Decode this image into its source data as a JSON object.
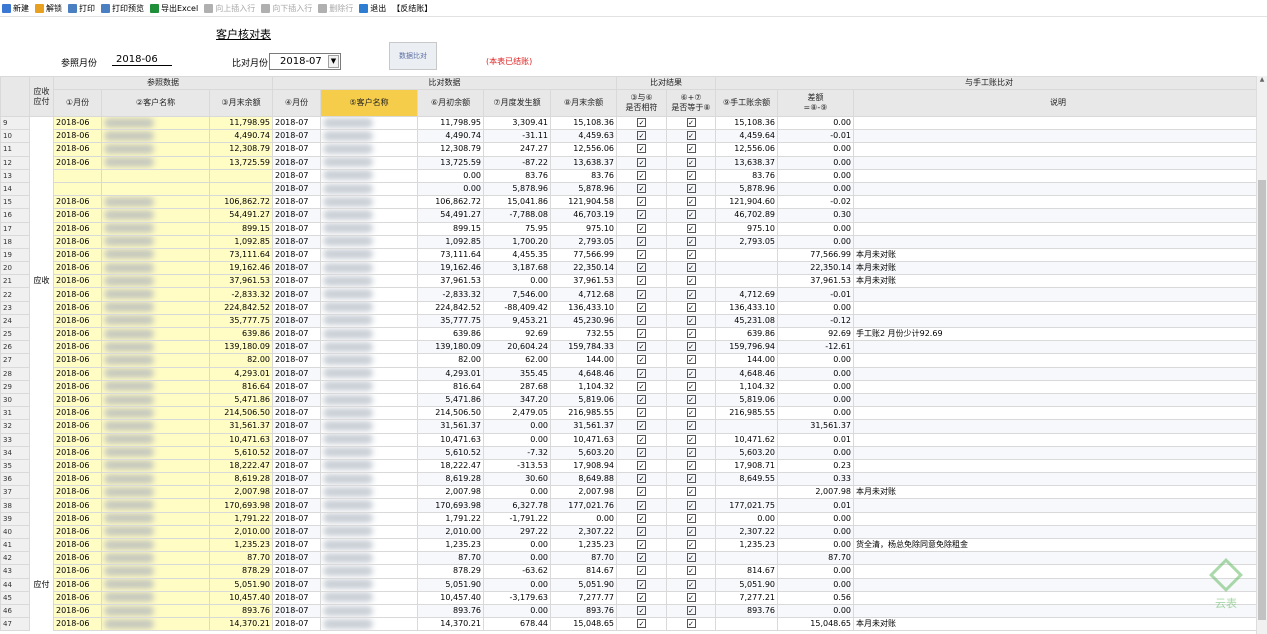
{
  "toolbar": {
    "items": [
      {
        "label": "新建",
        "icon": "new-icon",
        "enabled": true,
        "color": "#3a78d4"
      },
      {
        "label": "解锁",
        "icon": "unlock-icon",
        "enabled": true,
        "color": "#e8a020"
      },
      {
        "label": "打印",
        "icon": "print-icon",
        "enabled": true,
        "color": "#4a7fc1"
      },
      {
        "label": "打印预览",
        "icon": "print-preview-icon",
        "enabled": true,
        "color": "#4a7fc1"
      },
      {
        "label": "导出Excel",
        "icon": "excel-icon",
        "enabled": true,
        "color": "#1f8f3a"
      },
      {
        "label": "向上插入行",
        "icon": "insert-above-icon",
        "enabled": false,
        "color": "#b0b0b0"
      },
      {
        "label": "向下插入行",
        "icon": "insert-below-icon",
        "enabled": false,
        "color": "#b0b0b0"
      },
      {
        "label": "删除行",
        "icon": "delete-row-icon",
        "enabled": false,
        "color": "#b0b0b0"
      },
      {
        "label": "退出",
        "icon": "exit-icon",
        "enabled": true,
        "color": "#2d7dd2"
      },
      {
        "label": "【反结账】",
        "icon": "",
        "enabled": true,
        "color": ""
      }
    ]
  },
  "form": {
    "title": "客户核对表",
    "ref_month_label": "参照月份",
    "ref_month_value": "2018-06",
    "cmp_month_label": "比对月份",
    "cmp_month_value": "2018-07",
    "compare_button": "数据比对",
    "status_text": "(本表已结账)"
  },
  "grid": {
    "group_headers": {
      "type": "应收\n应付",
      "ref": "参照数据",
      "cmp": "比对数据",
      "result": "比对结果",
      "manual": "与手工账比对"
    },
    "columns": [
      "①月份",
      "②客户名称",
      "③月末余额",
      "④月份",
      "⑤客户名称",
      "⑥月初余额",
      "⑦月度发生额",
      "⑧月末余额",
      "③与⑥\n是否相符",
      "⑥+⑦\n是否等于⑧",
      "⑨手工账余额",
      "差额\n=⑧-⑨",
      "说明"
    ],
    "type_labels": [
      {
        "label": "应收",
        "row_index": 12
      },
      {
        "label": "应付",
        "row_index": 35
      }
    ],
    "rows": [
      {
        "n": "9",
        "m1": "2018-06",
        "e1": "11,798.95",
        "m2": "2018-07",
        "b": "11,798.95",
        "d": "3,309.41",
        "e": "15,108.36",
        "c1": true,
        "c2": true,
        "h": "15,108.36",
        "diff": "0.00",
        "note": ""
      },
      {
        "n": "10",
        "m1": "2018-06",
        "e1": "4,490.74",
        "m2": "2018-07",
        "b": "4,490.74",
        "d": "-31.11",
        "e": "4,459.63",
        "c1": true,
        "c2": true,
        "h": "4,459.64",
        "diff": "-0.01",
        "note": ""
      },
      {
        "n": "11",
        "m1": "2018-06",
        "e1": "12,308.79",
        "m2": "2018-07",
        "b": "12,308.79",
        "d": "247.27",
        "e": "12,556.06",
        "c1": true,
        "c2": true,
        "h": "12,556.06",
        "diff": "0.00",
        "note": ""
      },
      {
        "n": "12",
        "m1": "2018-06",
        "e1": "13,725.59",
        "m2": "2018-07",
        "b": "13,725.59",
        "d": "-87.22",
        "e": "13,638.37",
        "c1": true,
        "c2": true,
        "h": "13,638.37",
        "diff": "0.00",
        "note": ""
      },
      {
        "n": "13",
        "m1": "",
        "e1": "",
        "m2": "2018-07",
        "b": "0.00",
        "d": "83.76",
        "e": "83.76",
        "c1": true,
        "c2": true,
        "h": "83.76",
        "diff": "0.00",
        "note": ""
      },
      {
        "n": "14",
        "m1": "",
        "e1": "",
        "m2": "2018-07",
        "b": "0.00",
        "d": "5,878.96",
        "e": "5,878.96",
        "c1": true,
        "c2": true,
        "h": "5,878.96",
        "diff": "0.00",
        "note": ""
      },
      {
        "n": "15",
        "m1": "2018-06",
        "e1": "106,862.72",
        "m2": "2018-07",
        "b": "106,862.72",
        "d": "15,041.86",
        "e": "121,904.58",
        "c1": true,
        "c2": true,
        "h": "121,904.60",
        "diff": "-0.02",
        "note": ""
      },
      {
        "n": "16",
        "m1": "2018-06",
        "e1": "54,491.27",
        "m2": "2018-07",
        "b": "54,491.27",
        "d": "-7,788.08",
        "e": "46,703.19",
        "c1": true,
        "c2": true,
        "h": "46,702.89",
        "diff": "0.30",
        "note": ""
      },
      {
        "n": "17",
        "m1": "2018-06",
        "e1": "899.15",
        "m2": "2018-07",
        "b": "899.15",
        "d": "75.95",
        "e": "975.10",
        "c1": true,
        "c2": true,
        "h": "975.10",
        "diff": "0.00",
        "note": ""
      },
      {
        "n": "18",
        "m1": "2018-06",
        "e1": "1,092.85",
        "m2": "2018-07",
        "b": "1,092.85",
        "d": "1,700.20",
        "e": "2,793.05",
        "c1": true,
        "c2": true,
        "h": "2,793.05",
        "diff": "0.00",
        "note": ""
      },
      {
        "n": "19",
        "m1": "2018-06",
        "e1": "73,111.64",
        "m2": "2018-07",
        "b": "73,111.64",
        "d": "4,455.35",
        "e": "77,566.99",
        "c1": true,
        "c2": true,
        "h": "",
        "diff": "77,566.99",
        "note": "本月未对账"
      },
      {
        "n": "20",
        "m1": "2018-06",
        "e1": "19,162.46",
        "m2": "2018-07",
        "b": "19,162.46",
        "d": "3,187.68",
        "e": "22,350.14",
        "c1": true,
        "c2": true,
        "h": "",
        "diff": "22,350.14",
        "note": "本月未对账"
      },
      {
        "n": "21",
        "m1": "2018-06",
        "e1": "37,961.53",
        "m2": "2018-07",
        "b": "37,961.53",
        "d": "0.00",
        "e": "37,961.53",
        "c1": true,
        "c2": true,
        "h": "",
        "diff": "37,961.53",
        "note": "本月未对账"
      },
      {
        "n": "22",
        "m1": "2018-06",
        "e1": "-2,833.32",
        "m2": "2018-07",
        "b": "-2,833.32",
        "d": "7,546.00",
        "e": "4,712.68",
        "c1": true,
        "c2": true,
        "h": "4,712.69",
        "diff": "-0.01",
        "note": ""
      },
      {
        "n": "23",
        "m1": "2018-06",
        "e1": "224,842.52",
        "m2": "2018-07",
        "b": "224,842.52",
        "d": "-88,409.42",
        "e": "136,433.10",
        "c1": true,
        "c2": true,
        "h": "136,433.10",
        "diff": "0.00",
        "note": ""
      },
      {
        "n": "24",
        "m1": "2018-06",
        "e1": "35,777.75",
        "m2": "2018-07",
        "b": "35,777.75",
        "d": "9,453.21",
        "e": "45,230.96",
        "c1": true,
        "c2": true,
        "h": "45,231.08",
        "diff": "-0.12",
        "note": ""
      },
      {
        "n": "25",
        "m1": "2018-06",
        "e1": "639.86",
        "m2": "2018-07",
        "b": "639.86",
        "d": "92.69",
        "e": "732.55",
        "c1": true,
        "c2": true,
        "h": "639.86",
        "diff": "92.69",
        "note": "手工账2 月份少计92.69"
      },
      {
        "n": "26",
        "m1": "2018-06",
        "e1": "139,180.09",
        "m2": "2018-07",
        "b": "139,180.09",
        "d": "20,604.24",
        "e": "159,784.33",
        "c1": true,
        "c2": true,
        "h": "159,796.94",
        "diff": "-12.61",
        "note": ""
      },
      {
        "n": "27",
        "m1": "2018-06",
        "e1": "82.00",
        "m2": "2018-07",
        "b": "82.00",
        "d": "62.00",
        "e": "144.00",
        "c1": true,
        "c2": true,
        "h": "144.00",
        "diff": "0.00",
        "note": ""
      },
      {
        "n": "28",
        "m1": "2018-06",
        "e1": "4,293.01",
        "m2": "2018-07",
        "b": "4,293.01",
        "d": "355.45",
        "e": "4,648.46",
        "c1": true,
        "c2": true,
        "h": "4,648.46",
        "diff": "0.00",
        "note": ""
      },
      {
        "n": "29",
        "m1": "2018-06",
        "e1": "816.64",
        "m2": "2018-07",
        "b": "816.64",
        "d": "287.68",
        "e": "1,104.32",
        "c1": true,
        "c2": true,
        "h": "1,104.32",
        "diff": "0.00",
        "note": ""
      },
      {
        "n": "30",
        "m1": "2018-06",
        "e1": "5,471.86",
        "m2": "2018-07",
        "b": "5,471.86",
        "d": "347.20",
        "e": "5,819.06",
        "c1": true,
        "c2": true,
        "h": "5,819.06",
        "diff": "0.00",
        "note": ""
      },
      {
        "n": "31",
        "m1": "2018-06",
        "e1": "214,506.50",
        "m2": "2018-07",
        "b": "214,506.50",
        "d": "2,479.05",
        "e": "216,985.55",
        "c1": true,
        "c2": true,
        "h": "216,985.55",
        "diff": "0.00",
        "note": ""
      },
      {
        "n": "32",
        "m1": "2018-06",
        "e1": "31,561.37",
        "m2": "2018-07",
        "b": "31,561.37",
        "d": "0.00",
        "e": "31,561.37",
        "c1": true,
        "c2": true,
        "h": "",
        "diff": "31,561.37",
        "note": ""
      },
      {
        "n": "33",
        "m1": "2018-06",
        "e1": "10,471.63",
        "m2": "2018-07",
        "b": "10,471.63",
        "d": "0.00",
        "e": "10,471.63",
        "c1": true,
        "c2": true,
        "h": "10,471.62",
        "diff": "0.01",
        "note": ""
      },
      {
        "n": "34",
        "m1": "2018-06",
        "e1": "5,610.52",
        "m2": "2018-07",
        "b": "5,610.52",
        "d": "-7.32",
        "e": "5,603.20",
        "c1": true,
        "c2": true,
        "h": "5,603.20",
        "diff": "0.00",
        "note": ""
      },
      {
        "n": "35",
        "m1": "2018-06",
        "e1": "18,222.47",
        "m2": "2018-07",
        "b": "18,222.47",
        "d": "-313.53",
        "e": "17,908.94",
        "c1": true,
        "c2": true,
        "h": "17,908.71",
        "diff": "0.23",
        "note": ""
      },
      {
        "n": "36",
        "m1": "2018-06",
        "e1": "8,619.28",
        "m2": "2018-07",
        "b": "8,619.28",
        "d": "30.60",
        "e": "8,649.88",
        "c1": true,
        "c2": true,
        "h": "8,649.55",
        "diff": "0.33",
        "note": ""
      },
      {
        "n": "37",
        "m1": "2018-06",
        "e1": "2,007.98",
        "m2": "2018-07",
        "b": "2,007.98",
        "d": "0.00",
        "e": "2,007.98",
        "c1": true,
        "c2": true,
        "h": "",
        "diff": "2,007.98",
        "note": "本月未对账"
      },
      {
        "n": "38",
        "m1": "2018-06",
        "e1": "170,693.98",
        "m2": "2018-07",
        "b": "170,693.98",
        "d": "6,327.78",
        "e": "177,021.76",
        "c1": true,
        "c2": true,
        "h": "177,021.75",
        "diff": "0.01",
        "note": ""
      },
      {
        "n": "39",
        "m1": "2018-06",
        "e1": "1,791.22",
        "m2": "2018-07",
        "b": "1,791.22",
        "d": "-1,791.22",
        "e": "0.00",
        "c1": true,
        "c2": true,
        "h": "0.00",
        "diff": "0.00",
        "note": ""
      },
      {
        "n": "40",
        "m1": "2018-06",
        "e1": "2,010.00",
        "m2": "2018-07",
        "b": "2,010.00",
        "d": "297.22",
        "e": "2,307.22",
        "c1": true,
        "c2": true,
        "h": "2,307.22",
        "diff": "0.00",
        "note": ""
      },
      {
        "n": "41",
        "m1": "2018-06",
        "e1": "1,235.23",
        "m2": "2018-07",
        "b": "1,235.23",
        "d": "0.00",
        "e": "1,235.23",
        "c1": true,
        "c2": true,
        "h": "1,235.23",
        "diff": "0.00",
        "note": "货全清，杨总免除同意免除租金"
      },
      {
        "n": "42",
        "m1": "2018-06",
        "e1": "87.70",
        "m2": "2018-07",
        "b": "87.70",
        "d": "0.00",
        "e": "87.70",
        "c1": true,
        "c2": true,
        "h": "",
        "diff": "87.70",
        "note": ""
      },
      {
        "n": "43",
        "m1": "2018-06",
        "e1": "878.29",
        "m2": "2018-07",
        "b": "878.29",
        "d": "-63.62",
        "e": "814.67",
        "c1": true,
        "c2": true,
        "h": "814.67",
        "diff": "0.00",
        "note": ""
      },
      {
        "n": "44",
        "m1": "2018-06",
        "e1": "5,051.90",
        "m2": "2018-07",
        "b": "5,051.90",
        "d": "0.00",
        "e": "5,051.90",
        "c1": true,
        "c2": true,
        "h": "5,051.90",
        "diff": "0.00",
        "note": ""
      },
      {
        "n": "45",
        "m1": "2018-06",
        "e1": "10,457.40",
        "m2": "2018-07",
        "b": "10,457.40",
        "d": "-3,179.63",
        "e": "7,277.77",
        "c1": true,
        "c2": true,
        "h": "7,277.21",
        "diff": "0.56",
        "note": ""
      },
      {
        "n": "46",
        "m1": "2018-06",
        "e1": "893.76",
        "m2": "2018-07",
        "b": "893.76",
        "d": "0.00",
        "e": "893.76",
        "c1": true,
        "c2": true,
        "h": "893.76",
        "diff": "0.00",
        "note": ""
      },
      {
        "n": "47",
        "m1": "2018-06",
        "e1": "14,370.21",
        "m2": "2018-07",
        "b": "14,370.21",
        "d": "678.44",
        "e": "15,048.65",
        "c1": true,
        "c2": true,
        "h": "",
        "diff": "15,048.65",
        "note": "本月未对账"
      }
    ]
  },
  "watermark": {
    "text": "云表"
  },
  "colors": {
    "highlight_header": "#f5cd4a",
    "ref_col_bg": "#fffcc4",
    "status_red": "#e02020"
  }
}
